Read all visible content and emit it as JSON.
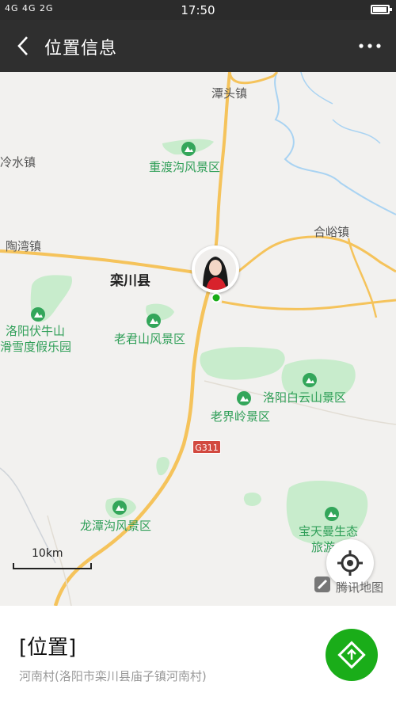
{
  "status_bar": {
    "signal_text": "4G 4G 2G",
    "time": "17:50",
    "battery_level": 0.95
  },
  "nav": {
    "title": "位置信息",
    "back_icon": "back-chevron-icon",
    "more_icon": "more-dots-icon"
  },
  "map": {
    "labels": {
      "tantou": "潭头镇",
      "lengshui": "冷水镇",
      "chongdu": "重渡沟风景区",
      "heyu": "合峪镇",
      "taowan": "陶湾镇",
      "luanchuan": "栾川县",
      "funiu_1": "洛阳伏牛山",
      "funiu_2": "滑雪度假乐园",
      "laojun": "老君山风景区",
      "baiyun": "洛阳白云山景区",
      "laojie": "老界岭景区",
      "longtan": "龙潭沟风景区",
      "baotian_1": "宝天曼生态",
      "baotian_2": "旅游"
    },
    "highway": "G311",
    "scale": "10km",
    "provider": "腾讯地图",
    "colors": {
      "road": "#f5c35b",
      "park": "#c8eccc",
      "water": "#a9d3f2",
      "poi": "#33a65a"
    }
  },
  "location": {
    "title": "[位置]",
    "address": "河南村(洛阳市栾川县庙子镇河南村)"
  },
  "colors": {
    "route_button": "#1aad19",
    "nav_bg": "#2f2f2f"
  }
}
